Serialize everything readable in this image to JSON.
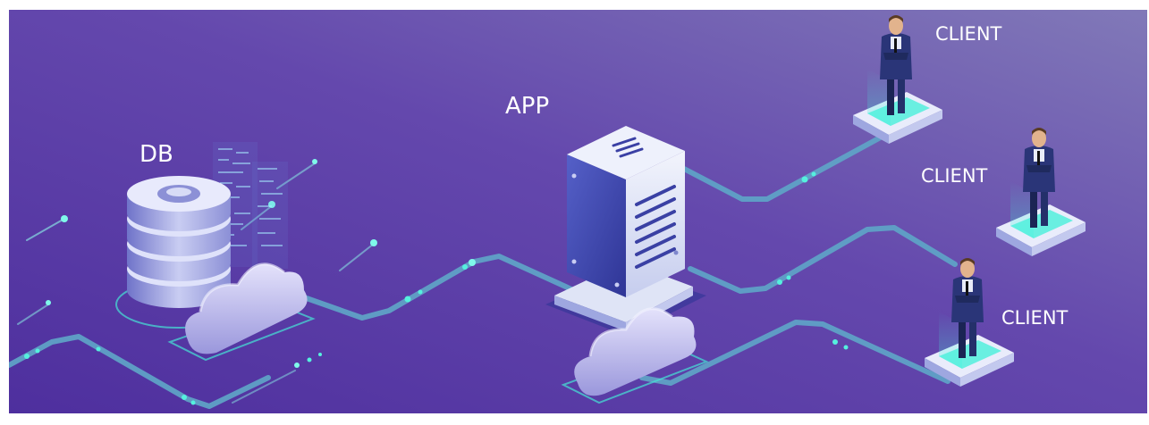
{
  "labels": {
    "db": "DB",
    "app": "APP",
    "client_1": "CLIENT",
    "client_2": "CLIENT",
    "client_3": "CLIENT"
  },
  "colors": {
    "background_start": "#5a3aa8",
    "background_end": "#7a72b6",
    "connection_line": "#5fa6c8",
    "glow": "#3ef0d8",
    "server_front": "#3b43a8",
    "server_side": "#dfe4f6",
    "cloud": "#c7c4ef",
    "suit": "#1f2a5e"
  },
  "icons": [
    "database-icon",
    "data-stream-icon",
    "cloud-icon",
    "server-icon",
    "person-icon",
    "platform-icon"
  ]
}
